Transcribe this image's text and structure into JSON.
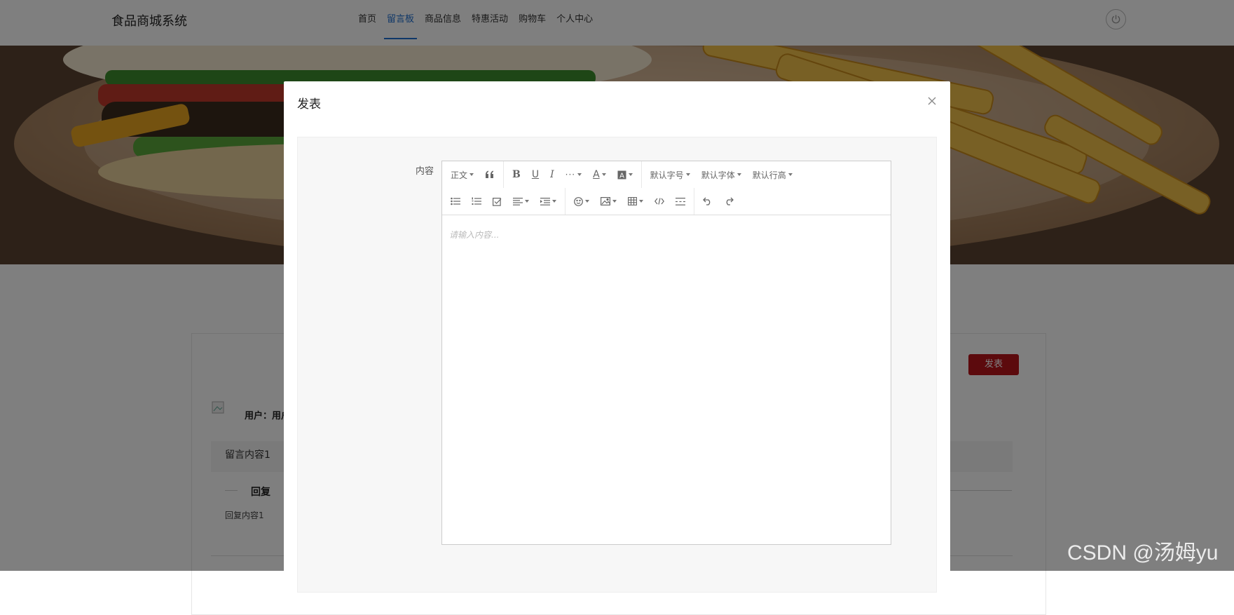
{
  "header": {
    "brand": "食品商城系统",
    "nav": [
      {
        "label": "首页",
        "active": false
      },
      {
        "label": "留言板",
        "active": true
      },
      {
        "label": "商品信息",
        "active": false
      },
      {
        "label": "特惠活动",
        "active": false
      },
      {
        "label": "购物车",
        "active": false
      },
      {
        "label": "个人中心",
        "active": false
      }
    ],
    "power_icon": "power-icon",
    "accent": "#1e6fd0"
  },
  "board": {
    "post_button": "发表",
    "user_label": "用户：用户",
    "message": "留言内容1",
    "reply_title": "回复",
    "reply_content": "回复内容1",
    "post_color": "#b8141b"
  },
  "modal": {
    "title": "发表",
    "close_icon": "close-icon",
    "field_label": "内容",
    "editor": {
      "toolbar_row1": [
        {
          "name": "heading",
          "label": "正文",
          "dropdown": true
        },
        {
          "name": "quote",
          "icon": "quote-icon"
        },
        {
          "name": "bold",
          "icon": "bold-icon"
        },
        {
          "name": "underline",
          "icon": "underline-icon"
        },
        {
          "name": "italic",
          "icon": "italic-icon"
        },
        {
          "name": "more",
          "icon": "more-icon",
          "dropdown": true
        },
        {
          "name": "font-color",
          "icon": "font-color-icon",
          "dropdown": true
        },
        {
          "name": "bg-color",
          "icon": "bg-color-icon",
          "dropdown": true
        },
        {
          "name": "font-size",
          "label": "默认字号",
          "dropdown": true
        },
        {
          "name": "font-family",
          "label": "默认字体",
          "dropdown": true
        },
        {
          "name": "line-height",
          "label": "默认行高",
          "dropdown": true
        }
      ],
      "toolbar_row2": [
        "bullet-list-icon",
        "numbered-list-icon",
        "todo-icon",
        "align-icon",
        "indent-icon",
        "emoji-icon",
        "image-icon",
        "table-icon",
        "code-icon",
        "divider-icon",
        "undo-icon",
        "redo-icon"
      ],
      "placeholder": "请输入内容..."
    }
  },
  "watermark": "CSDN @汤姆yu"
}
